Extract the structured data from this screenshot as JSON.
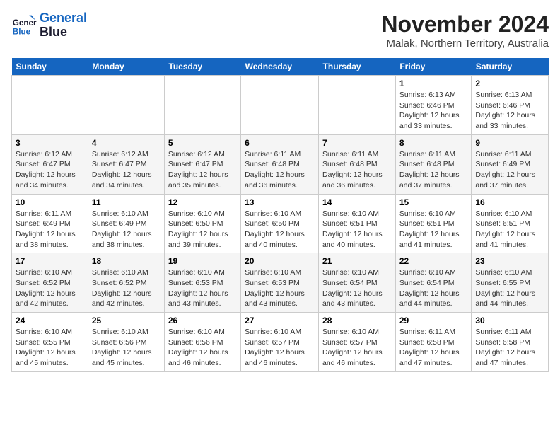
{
  "logo": {
    "line1": "General",
    "line2": "Blue"
  },
  "title": "November 2024",
  "location": "Malak, Northern Territory, Australia",
  "days_of_week": [
    "Sunday",
    "Monday",
    "Tuesday",
    "Wednesday",
    "Thursday",
    "Friday",
    "Saturday"
  ],
  "weeks": [
    [
      {
        "day": "",
        "info": ""
      },
      {
        "day": "",
        "info": ""
      },
      {
        "day": "",
        "info": ""
      },
      {
        "day": "",
        "info": ""
      },
      {
        "day": "",
        "info": ""
      },
      {
        "day": "1",
        "info": "Sunrise: 6:13 AM\nSunset: 6:46 PM\nDaylight: 12 hours\nand 33 minutes."
      },
      {
        "day": "2",
        "info": "Sunrise: 6:13 AM\nSunset: 6:46 PM\nDaylight: 12 hours\nand 33 minutes."
      }
    ],
    [
      {
        "day": "3",
        "info": "Sunrise: 6:12 AM\nSunset: 6:47 PM\nDaylight: 12 hours\nand 34 minutes."
      },
      {
        "day": "4",
        "info": "Sunrise: 6:12 AM\nSunset: 6:47 PM\nDaylight: 12 hours\nand 34 minutes."
      },
      {
        "day": "5",
        "info": "Sunrise: 6:12 AM\nSunset: 6:47 PM\nDaylight: 12 hours\nand 35 minutes."
      },
      {
        "day": "6",
        "info": "Sunrise: 6:11 AM\nSunset: 6:48 PM\nDaylight: 12 hours\nand 36 minutes."
      },
      {
        "day": "7",
        "info": "Sunrise: 6:11 AM\nSunset: 6:48 PM\nDaylight: 12 hours\nand 36 minutes."
      },
      {
        "day": "8",
        "info": "Sunrise: 6:11 AM\nSunset: 6:48 PM\nDaylight: 12 hours\nand 37 minutes."
      },
      {
        "day": "9",
        "info": "Sunrise: 6:11 AM\nSunset: 6:49 PM\nDaylight: 12 hours\nand 37 minutes."
      }
    ],
    [
      {
        "day": "10",
        "info": "Sunrise: 6:11 AM\nSunset: 6:49 PM\nDaylight: 12 hours\nand 38 minutes."
      },
      {
        "day": "11",
        "info": "Sunrise: 6:10 AM\nSunset: 6:49 PM\nDaylight: 12 hours\nand 38 minutes."
      },
      {
        "day": "12",
        "info": "Sunrise: 6:10 AM\nSunset: 6:50 PM\nDaylight: 12 hours\nand 39 minutes."
      },
      {
        "day": "13",
        "info": "Sunrise: 6:10 AM\nSunset: 6:50 PM\nDaylight: 12 hours\nand 40 minutes."
      },
      {
        "day": "14",
        "info": "Sunrise: 6:10 AM\nSunset: 6:51 PM\nDaylight: 12 hours\nand 40 minutes."
      },
      {
        "day": "15",
        "info": "Sunrise: 6:10 AM\nSunset: 6:51 PM\nDaylight: 12 hours\nand 41 minutes."
      },
      {
        "day": "16",
        "info": "Sunrise: 6:10 AM\nSunset: 6:51 PM\nDaylight: 12 hours\nand 41 minutes."
      }
    ],
    [
      {
        "day": "17",
        "info": "Sunrise: 6:10 AM\nSunset: 6:52 PM\nDaylight: 12 hours\nand 42 minutes."
      },
      {
        "day": "18",
        "info": "Sunrise: 6:10 AM\nSunset: 6:52 PM\nDaylight: 12 hours\nand 42 minutes."
      },
      {
        "day": "19",
        "info": "Sunrise: 6:10 AM\nSunset: 6:53 PM\nDaylight: 12 hours\nand 43 minutes."
      },
      {
        "day": "20",
        "info": "Sunrise: 6:10 AM\nSunset: 6:53 PM\nDaylight: 12 hours\nand 43 minutes."
      },
      {
        "day": "21",
        "info": "Sunrise: 6:10 AM\nSunset: 6:54 PM\nDaylight: 12 hours\nand 43 minutes."
      },
      {
        "day": "22",
        "info": "Sunrise: 6:10 AM\nSunset: 6:54 PM\nDaylight: 12 hours\nand 44 minutes."
      },
      {
        "day": "23",
        "info": "Sunrise: 6:10 AM\nSunset: 6:55 PM\nDaylight: 12 hours\nand 44 minutes."
      }
    ],
    [
      {
        "day": "24",
        "info": "Sunrise: 6:10 AM\nSunset: 6:55 PM\nDaylight: 12 hours\nand 45 minutes."
      },
      {
        "day": "25",
        "info": "Sunrise: 6:10 AM\nSunset: 6:56 PM\nDaylight: 12 hours\nand 45 minutes."
      },
      {
        "day": "26",
        "info": "Sunrise: 6:10 AM\nSunset: 6:56 PM\nDaylight: 12 hours\nand 46 minutes."
      },
      {
        "day": "27",
        "info": "Sunrise: 6:10 AM\nSunset: 6:57 PM\nDaylight: 12 hours\nand 46 minutes."
      },
      {
        "day": "28",
        "info": "Sunrise: 6:10 AM\nSunset: 6:57 PM\nDaylight: 12 hours\nand 46 minutes."
      },
      {
        "day": "29",
        "info": "Sunrise: 6:11 AM\nSunset: 6:58 PM\nDaylight: 12 hours\nand 47 minutes."
      },
      {
        "day": "30",
        "info": "Sunrise: 6:11 AM\nSunset: 6:58 PM\nDaylight: 12 hours\nand 47 minutes."
      }
    ]
  ]
}
